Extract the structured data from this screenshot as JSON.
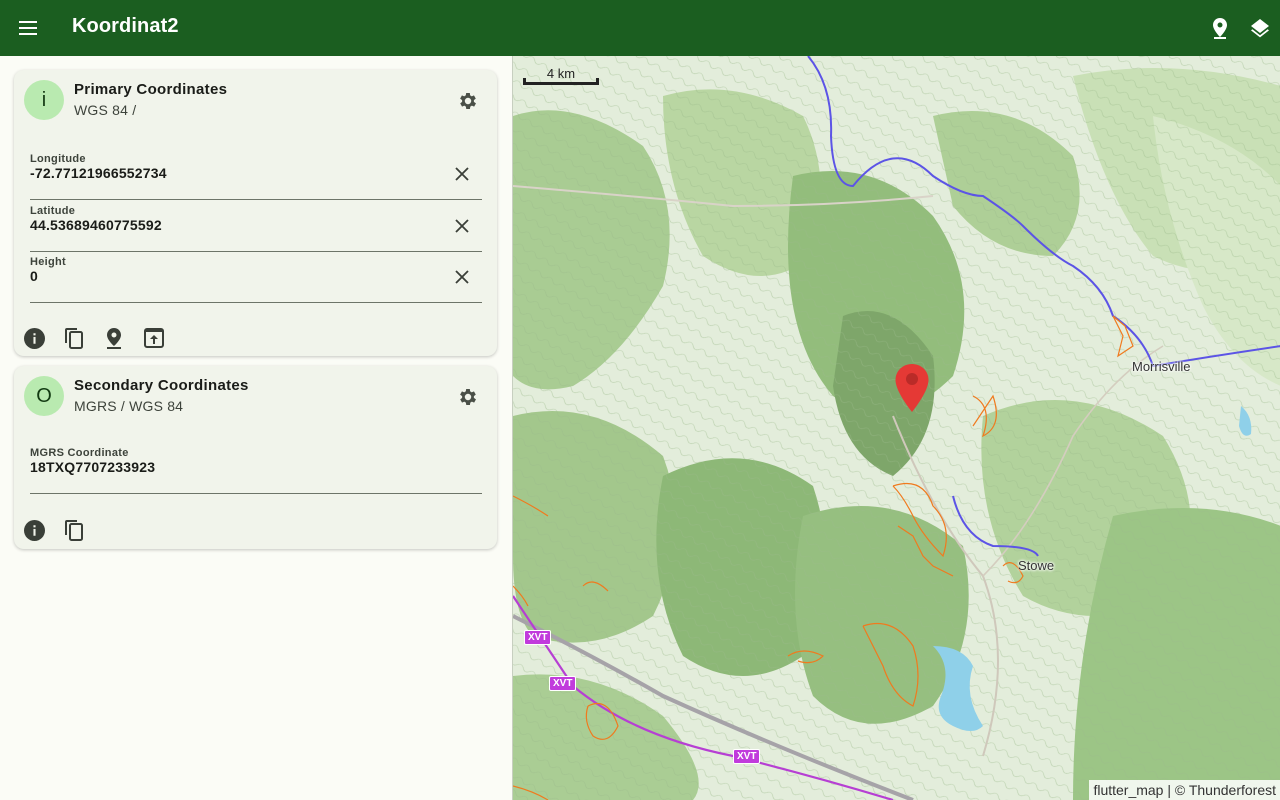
{
  "appbar": {
    "title": "Koordinat2",
    "background": "#1b5e20"
  },
  "primary": {
    "avatar": "i",
    "title": "Primary Coordinates",
    "subtitle": "WGS 84 /",
    "fields": [
      {
        "label": "Longitude",
        "value": "-72.77121966552734"
      },
      {
        "label": "Latitude",
        "value": "44.53689460775592"
      },
      {
        "label": "Height",
        "value": "0"
      }
    ],
    "actions": [
      "info-icon",
      "copy-icon",
      "pin-icon",
      "open-in-icon"
    ]
  },
  "secondary": {
    "avatar": "O",
    "title": "Secondary Coordinates",
    "subtitle": "MGRS / WGS 84",
    "fields": [
      {
        "label": "MGRS Coordinate",
        "value": "18TXQ7707233923"
      }
    ],
    "actions": [
      "info-icon",
      "copy-icon"
    ]
  },
  "map": {
    "scale_label": "4 km",
    "places": {
      "morrisville": "Morrisville",
      "stowe": "Stowe"
    },
    "highway_shields": {
      "a": "XVT",
      "b": "XVT",
      "c": "XVT"
    },
    "attribution": "flutter_map | © Thunderforest",
    "marker_color": "#e53935"
  }
}
